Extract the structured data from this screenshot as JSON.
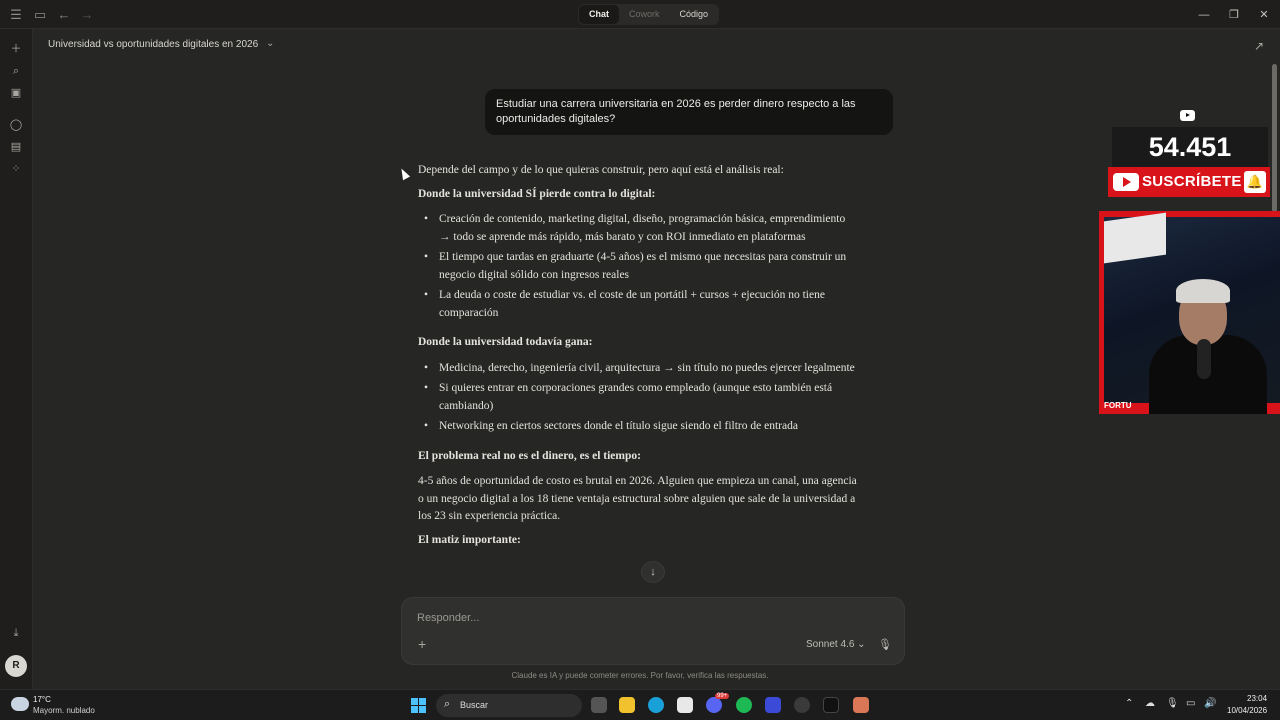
{
  "titlebar": {
    "tabs": [
      "Chat",
      "Cowork",
      "Código"
    ],
    "active_tab": "Chat"
  },
  "conversation": {
    "title": "Universidad vs oportunidades digitales en 2026"
  },
  "user_message": "Estudiar una carrera universitaria en 2026 es perder dinero respecto a las oportunidades digitales?",
  "answer": {
    "intro": "Depende del campo y de lo que quieras construir, pero aquí está el análisis real:",
    "section1_heading": "Donde la universidad SÍ pierde contra lo digital:",
    "section1_items": [
      "Creación de contenido, marketing digital, diseño, programación básica, emprendimiento → todo se aprende más rápido, más barato y con ROI inmediato en plataformas",
      "El tiempo que tardas en graduarte (4-5 años) es el mismo que necesitas para construir un negocio digital sólido con ingresos reales",
      "La deuda o coste de estudiar vs. el coste de un portátil + cursos + ejecución no tiene comparación"
    ],
    "section2_heading": "Donde la universidad todavía gana:",
    "section2_items": [
      "Medicina, derecho, ingeniería civil, arquitectura → sin título no puedes ejercer legalmente",
      "Si quieres entrar en corporaciones grandes como empleado (aunque esto también está cambiando)",
      "Networking en ciertos sectores donde el título sigue siendo el filtro de entrada"
    ],
    "section3_heading": "El problema real no es el dinero, es el tiempo:",
    "section3_text": "4-5 años de oportunidad de costo es brutal en 2026. Alguien que empieza un canal, una agencia o un negocio digital a los 18 tiene ventaja estructural sobre alguien que sale de la universidad a los 23 sin experiencia práctica.",
    "section4_heading": "El matiz importante:"
  },
  "composer": {
    "placeholder": "Responder...",
    "model": "Sonnet 4.6 ⌄"
  },
  "disclaimer": "Claude es IA y puede cometer errores. Por favor, verifica las respuestas.",
  "overlay": {
    "subscriber_count": "54.451",
    "subscribe_label": "SUSCRÍBETE",
    "streamer_name": "FORTU"
  },
  "taskbar": {
    "temperature": "17°C",
    "weather": "Mayorm. nublado",
    "search_label": "Buscar",
    "time": "23:04",
    "date": "10/04/2026",
    "discord_badge": "99+"
  }
}
